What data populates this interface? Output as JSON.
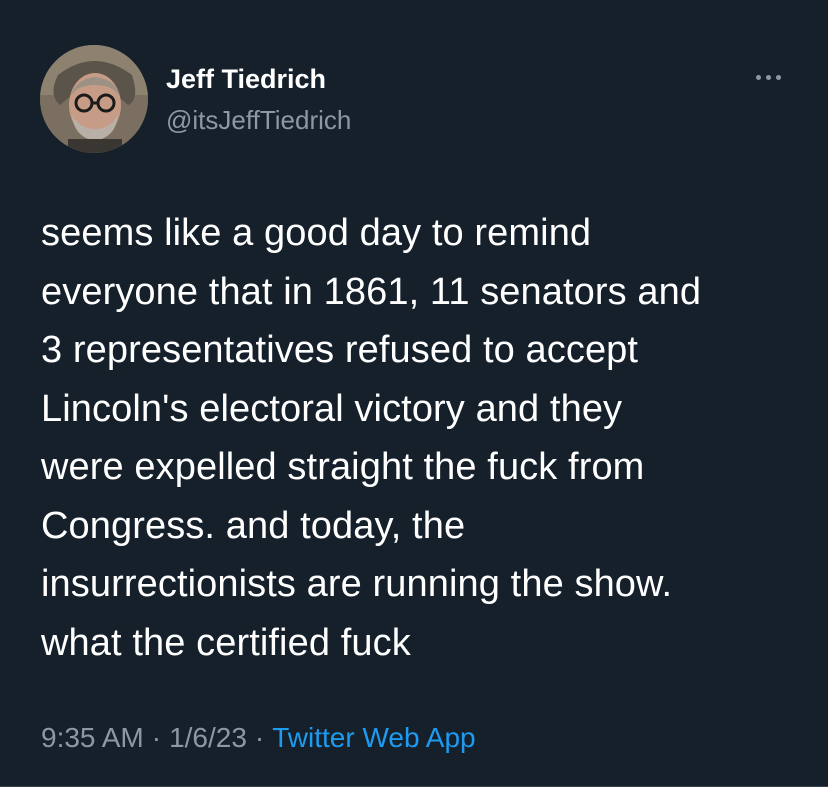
{
  "tweet": {
    "author": {
      "display_name": "Jeff Tiedrich",
      "handle": "@itsJeffTiedrich",
      "avatar_icon": "profile-photo"
    },
    "more_icon": "more-horizontal-icon",
    "text": "seems like a good day to remind\neveryone that in 1861, 11 senators and\n3 representatives refused to accept\nLincoln's electoral victory and they\nwere expelled straight the fuck from\nCongress. and today, the\ninsurrectionists are running the show.\nwhat the certified fuck",
    "time": "9:35 AM",
    "separator": "·",
    "date": "1/6/23",
    "source": "Twitter Web App"
  },
  "colors": {
    "background": "#15202b",
    "primary_text": "#ffffff",
    "secondary_text": "#8b98a5",
    "link": "#1d9bf0"
  }
}
